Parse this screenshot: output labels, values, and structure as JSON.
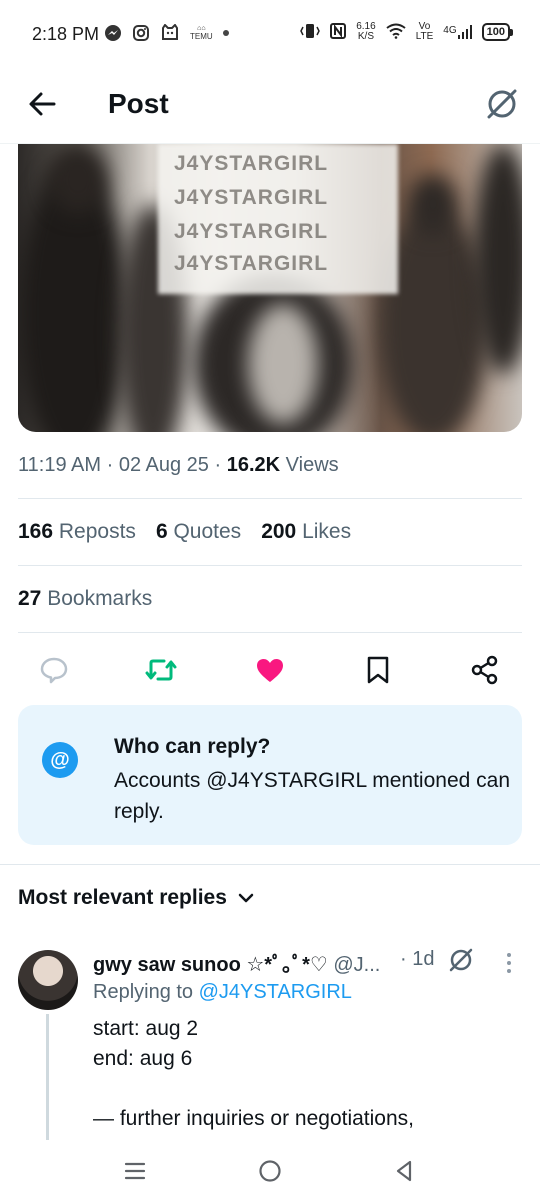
{
  "status_bar": {
    "time": "2:18 PM",
    "net_speed_value": "6.16",
    "net_speed_unit": "K/S",
    "volte_top": "Vo",
    "volte_bottom": "LTE",
    "network": "4G",
    "battery": "100",
    "temu_label": "TEMU"
  },
  "header": {
    "title": "Post"
  },
  "media": {
    "watermark_lines": [
      "J4YSTARGIRL",
      "J4YSTARGIRL",
      "J4YSTARGIRL",
      "J4YSTARGIRL"
    ]
  },
  "post": {
    "time": "11:19 AM",
    "date": "02 Aug 25",
    "views_count": "16.2K",
    "views_label": "Views",
    "reposts_count": "166",
    "reposts_label": "Reposts",
    "quotes_count": "6",
    "quotes_label": "Quotes",
    "likes_count": "200",
    "likes_label": "Likes",
    "bookmarks_count": "27",
    "bookmarks_label": "Bookmarks",
    "separator": "·"
  },
  "colors": {
    "accent": "#1d9bf0",
    "repost_green": "#00ba7c",
    "like_pink": "#f91880",
    "muted": "#536471"
  },
  "who_can_reply": {
    "icon": "@",
    "title": "Who can reply?",
    "body": "Accounts @J4YSTARGIRL mentioned can reply."
  },
  "replies": {
    "sort_label": "Most relevant replies",
    "items": [
      {
        "name": "gwy saw sunoo ☆*ﾟ｡ﾟ*♡",
        "handle": "@J...",
        "time": "· 1d",
        "replying_prefix": "Replying to",
        "replying_to": "@J4YSTARGIRL",
        "line1": "start: aug 2",
        "line2": "end: aug 6",
        "line3": "— further inquiries or negotiations,"
      }
    ]
  }
}
